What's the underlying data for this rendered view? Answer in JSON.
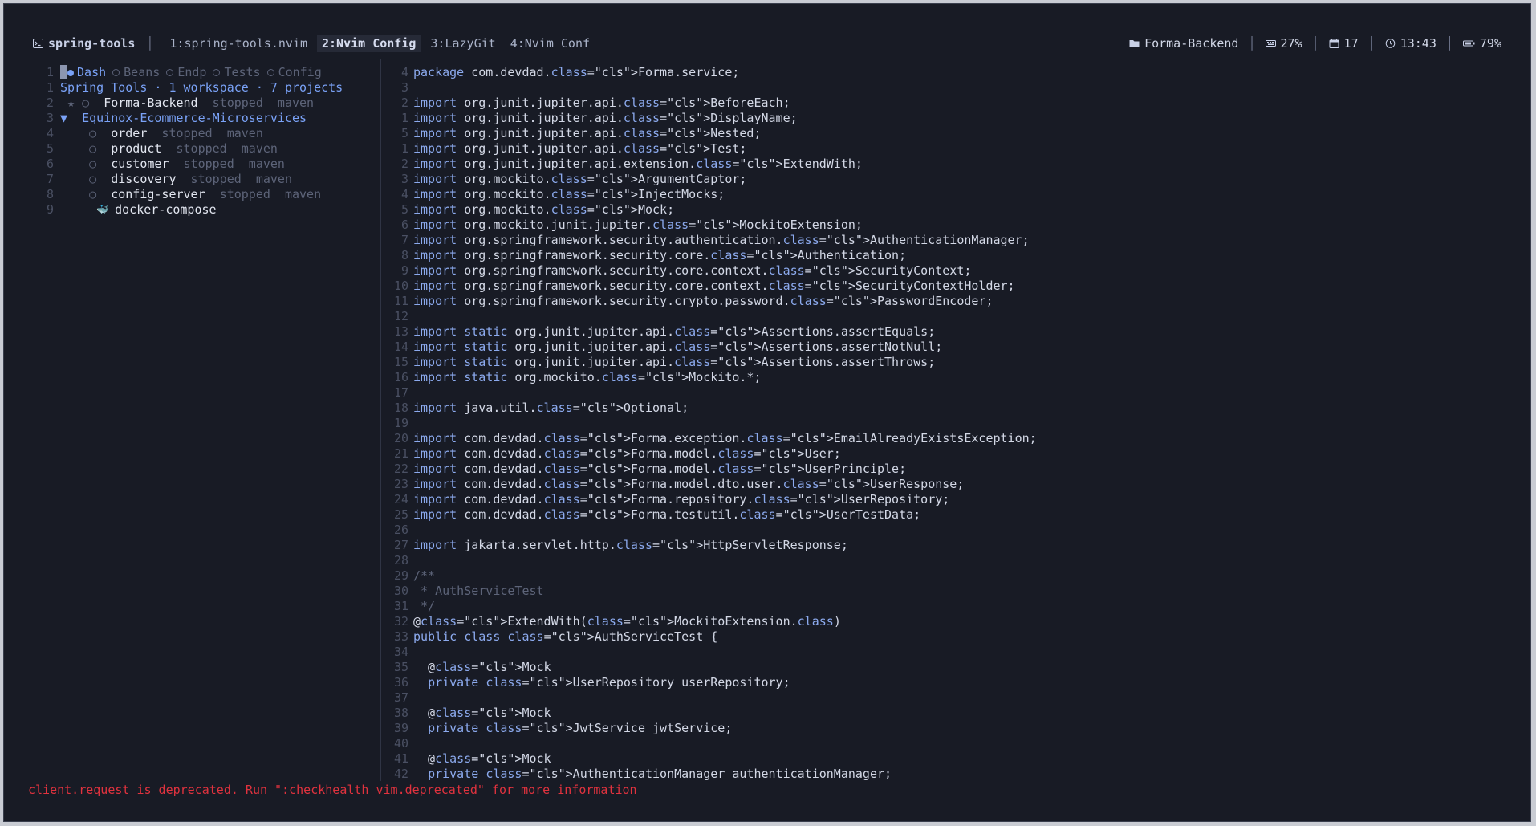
{
  "tabline": {
    "session": "spring-tools",
    "tabs": [
      "1:spring-tools.nvim",
      "2:Nvim Config",
      "3:LazyGit",
      "4:Nvim Conf"
    ],
    "active_tab_index": 1,
    "status": {
      "project": "Forma-Backend",
      "cpu": "27%",
      "date": "17",
      "time": "13:43",
      "battery": "79%"
    }
  },
  "left_pane": {
    "tabs": [
      "Dash",
      "Beans",
      "Endp",
      "Tests",
      "Config"
    ],
    "summary": "Spring Tools · 1 workspace · 7 projects",
    "lines": [
      {
        "num": "2",
        "prefix": "★ ○",
        "name": "Forma-Backend",
        "status": "stopped",
        "tool": "maven",
        "indent": 0
      },
      {
        "num": "3",
        "prefix": "▼",
        "name": "Equinox-Ecommerce-Microservices",
        "status": "",
        "tool": "",
        "indent": 0
      },
      {
        "num": "4",
        "prefix": "○",
        "name": "order",
        "status": "stopped",
        "tool": "maven",
        "indent": 1
      },
      {
        "num": "5",
        "prefix": "○",
        "name": "product",
        "status": "stopped",
        "tool": "maven",
        "indent": 1
      },
      {
        "num": "6",
        "prefix": "○",
        "name": "customer",
        "status": "stopped",
        "tool": "maven",
        "indent": 1
      },
      {
        "num": "7",
        "prefix": "○",
        "name": "discovery",
        "status": "stopped",
        "tool": "maven",
        "indent": 1
      },
      {
        "num": "8",
        "prefix": "○",
        "name": "config-server",
        "status": "stopped",
        "tool": "maven",
        "indent": 1
      },
      {
        "num": "9",
        "prefix": "",
        "name": "docker-compose",
        "status": "",
        "tool": "",
        "indent": 2
      }
    ]
  },
  "editor": {
    "lines": [
      {
        "n": "4",
        "t": "package com.devdad.Forma.service;"
      },
      {
        "n": "3",
        "t": ""
      },
      {
        "n": "2",
        "t": "import org.junit.jupiter.api.BeforeEach;"
      },
      {
        "n": "1",
        "t": "import org.junit.jupiter.api.DisplayName;"
      },
      {
        "n": "5",
        "t": "import org.junit.jupiter.api.Nested;"
      },
      {
        "n": "1",
        "t": "import org.junit.jupiter.api.Test;"
      },
      {
        "n": "2",
        "t": "import org.junit.jupiter.api.extension.ExtendWith;"
      },
      {
        "n": "3",
        "t": "import org.mockito.ArgumentCaptor;"
      },
      {
        "n": "4",
        "t": "import org.mockito.InjectMocks;"
      },
      {
        "n": "5",
        "t": "import org.mockito.Mock;"
      },
      {
        "n": "6",
        "t": "import org.mockito.junit.jupiter.MockitoExtension;"
      },
      {
        "n": "7",
        "t": "import org.springframework.security.authentication.AuthenticationManager;"
      },
      {
        "n": "8",
        "t": "import org.springframework.security.core.Authentication;"
      },
      {
        "n": "9",
        "t": "import org.springframework.security.core.context.SecurityContext;"
      },
      {
        "n": "10",
        "t": "import org.springframework.security.core.context.SecurityContextHolder;"
      },
      {
        "n": "11",
        "t": "import org.springframework.security.crypto.password.PasswordEncoder;"
      },
      {
        "n": "12",
        "t": ""
      },
      {
        "n": "13",
        "t": "import static org.junit.jupiter.api.Assertions.assertEquals;"
      },
      {
        "n": "14",
        "t": "import static org.junit.jupiter.api.Assertions.assertNotNull;"
      },
      {
        "n": "15",
        "t": "import static org.junit.jupiter.api.Assertions.assertThrows;"
      },
      {
        "n": "16",
        "t": "import static org.mockito.Mockito.*;"
      },
      {
        "n": "17",
        "t": ""
      },
      {
        "n": "18",
        "t": "import java.util.Optional;"
      },
      {
        "n": "19",
        "t": ""
      },
      {
        "n": "20",
        "t": "import com.devdad.Forma.exception.EmailAlreadyExistsException;"
      },
      {
        "n": "21",
        "t": "import com.devdad.Forma.model.User;"
      },
      {
        "n": "22",
        "t": "import com.devdad.Forma.model.UserPrinciple;"
      },
      {
        "n": "23",
        "t": "import com.devdad.Forma.model.dto.user.UserResponse;"
      },
      {
        "n": "24",
        "t": "import com.devdad.Forma.repository.UserRepository;"
      },
      {
        "n": "25",
        "t": "import com.devdad.Forma.testutil.UserTestData;"
      },
      {
        "n": "26",
        "t": ""
      },
      {
        "n": "27",
        "t": "import jakarta.servlet.http.HttpServletResponse;"
      },
      {
        "n": "28",
        "t": ""
      },
      {
        "n": "29",
        "t": "/**"
      },
      {
        "n": "30",
        "t": " * AuthServiceTest"
      },
      {
        "n": "31",
        "t": " */"
      },
      {
        "n": "32",
        "t": "@ExtendWith(MockitoExtension.class)"
      },
      {
        "n": "33",
        "t": "public class AuthServiceTest {"
      },
      {
        "n": "34",
        "t": ""
      },
      {
        "n": "35",
        "t": "  @Mock"
      },
      {
        "n": "36",
        "t": "  private UserRepository userRepository;"
      },
      {
        "n": "37",
        "t": ""
      },
      {
        "n": "38",
        "t": "  @Mock"
      },
      {
        "n": "39",
        "t": "  private JwtService jwtService;"
      },
      {
        "n": "40",
        "t": ""
      },
      {
        "n": "41",
        "t": "  @Mock"
      },
      {
        "n": "42",
        "t": "  private AuthenticationManager authenticationManager;"
      }
    ]
  },
  "message": "client.request is deprecated. Run \":checkhealth vim.deprecated\" for more information",
  "colors": {
    "background": "#181b25",
    "accent": "#7aa2f7",
    "error": "#e0323e",
    "muted": "#5d6479"
  }
}
